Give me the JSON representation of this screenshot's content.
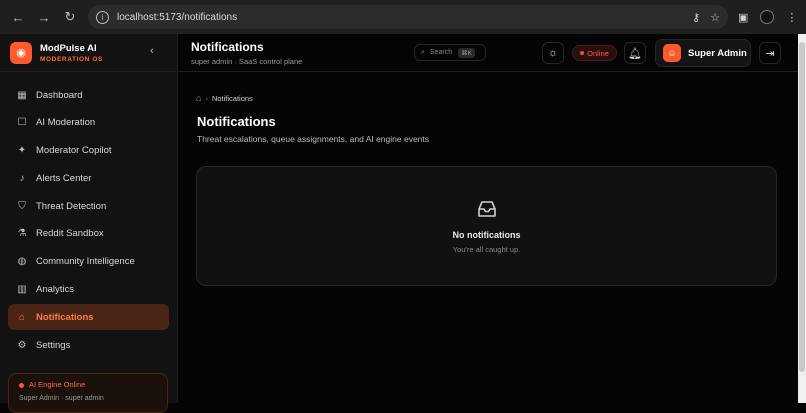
{
  "browser": {
    "url": "localhost:5173/notifications"
  },
  "brand": {
    "name": "ModPulse AI",
    "tagline": "MODERATION OS"
  },
  "sidebar": {
    "items": [
      {
        "label": "Dashboard",
        "icon": "grid-icon"
      },
      {
        "label": "AI Moderation",
        "icon": "robot-icon"
      },
      {
        "label": "Moderator Copilot",
        "icon": "sparkle-icon"
      },
      {
        "label": "Alerts Center",
        "icon": "bell-icon"
      },
      {
        "label": "Threat Detection",
        "icon": "shield-icon"
      },
      {
        "label": "Reddit Sandbox",
        "icon": "flask-icon"
      },
      {
        "label": "Community Intelligence",
        "icon": "globe-icon"
      },
      {
        "label": "Analytics",
        "icon": "bar-chart-icon"
      },
      {
        "label": "Notifications",
        "icon": "inbox-icon",
        "active": true
      },
      {
        "label": "Settings",
        "icon": "gear-icon"
      }
    ],
    "engine": {
      "status": "AI Engine Online",
      "user": "Super Admin · super admin"
    }
  },
  "header": {
    "title": "Notifications",
    "subtitle": "super admin · SaaS control plane",
    "search_placeholder": "Search",
    "search_shortcut": "⌘K",
    "status": "Online",
    "user_name": "Super Admin"
  },
  "breadcrumb": {
    "current": "Notifications"
  },
  "page": {
    "title": "Notifications",
    "description": "Threat escalations, queue assignments, and AI engine events"
  },
  "empty_state": {
    "title": "No notifications",
    "subtitle": "You're all caught up."
  },
  "colors": {
    "accent": "#ff5a2b",
    "background": "#050505",
    "sidebar": "#121212",
    "active_bg": "#4a2414"
  }
}
